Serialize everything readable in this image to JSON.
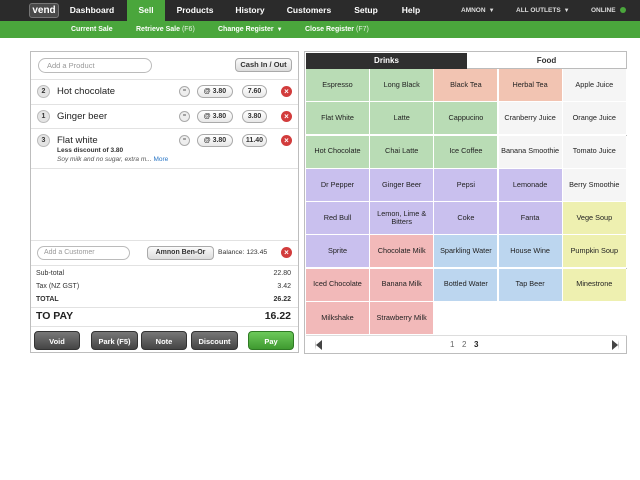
{
  "nav": {
    "logo": "vend",
    "items": [
      "Dashboard",
      "Sell",
      "Products",
      "History",
      "Customers",
      "Setup",
      "Help"
    ],
    "user": "AMNON",
    "outlets": "ALL OUTLETS",
    "status": "ONLINE"
  },
  "subnav": {
    "current_sale": "Current Sale",
    "retrieve_sale": "Retrieve Sale",
    "retrieve_hint": "(F6)",
    "change_register": "Change Register",
    "close_register": "Close Register",
    "close_hint": "(F7)"
  },
  "sale": {
    "add_product_placeholder": "Add a Product",
    "cash_in_out": "Cash In / Out",
    "lines": [
      {
        "qty": "2",
        "name": "Hot chocolate",
        "price": "@ 3.80",
        "total": "7.60",
        "discount": "",
        "note": "",
        "more": ""
      },
      {
        "qty": "1",
        "name": "Ginger beer",
        "price": "@ 3.80",
        "total": "3.80",
        "discount": "",
        "note": "",
        "more": ""
      },
      {
        "qty": "3",
        "name": "Flat white",
        "price": "@ 3.80",
        "total": "11.40",
        "discount": "Less discount of 3.80",
        "note": "Soy milk and no sugar, extra m...",
        "more": "More"
      }
    ],
    "eq_symbol": "=",
    "add_customer_placeholder": "Add a Customer",
    "customer": "Amnon Ben-Or",
    "balance": "Balance: 123.45",
    "subtotal_label": "Sub-total",
    "subtotal": "22.80",
    "tax_label": "Tax (NZ GST)",
    "tax": "3.42",
    "total_label": "TOTAL",
    "total": "26.22",
    "topay_label": "TO PAY",
    "topay": "16.22",
    "buttons": {
      "void": "Void",
      "park": "Park (F5)",
      "note": "Note",
      "discount": "Discount",
      "pay": "Pay"
    }
  },
  "quick_keys": {
    "tabs": [
      "Drinks",
      "Food"
    ],
    "tiles": [
      [
        "Espresso",
        "Long Black",
        "Black Tea",
        "Herbal Tea",
        "Apple Juice"
      ],
      [
        "Flat White",
        "Latte",
        "Cappucino",
        "Cranberry Juice",
        "Orange Juice"
      ],
      [
        "Hot Chocolate",
        "Chai Latte",
        "Ice Coffee",
        "Banana Smoothie",
        "Tomato Juice"
      ],
      [
        "Dr Pepper",
        "Ginger Beer",
        "Pepsi",
        "Lemonade",
        "Berry Smoothie"
      ],
      [
        "Red Bull",
        "Lemon, Lime & Bitters",
        "Coke",
        "Fanta",
        "Vege Soup"
      ],
      [
        "Sprite",
        "Chocolate Milk",
        "Sparkling Water",
        "House Wine",
        "Pumpkin Soup"
      ],
      [
        "Iced Chocolate",
        "Banana Milk",
        "Bottled Water",
        "Tap Beer",
        "Minestrone"
      ],
      [
        "Milkshake",
        "Strawberry Milk",
        "",
        "",
        ""
      ]
    ],
    "colors": [
      [
        "#b9dcb5",
        "#b9dcb5",
        "#f2c4b2",
        "#f2c4b2",
        "#f5f5f5"
      ],
      [
        "#b9dcb5",
        "#b9dcb5",
        "#b9dcb5",
        "#f5f5f5",
        "#f5f5f5"
      ],
      [
        "#b9dcb5",
        "#b9dcb5",
        "#b9dcb5",
        "#f5f5f5",
        "#f5f5f5"
      ],
      [
        "#c9c0ee",
        "#c9c0ee",
        "#c9c0ee",
        "#c9c0ee",
        "#f5f5f5"
      ],
      [
        "#c9c0ee",
        "#c9c0ee",
        "#c9c0ee",
        "#c9c0ee",
        "#eef0b0"
      ],
      [
        "#c9c0ee",
        "#f2b9b9",
        "#bcd6ef",
        "#bcd6ef",
        "#eef0b0"
      ],
      [
        "#f2b9b9",
        "#f2b9b9",
        "#bcd6ef",
        "#bcd6ef",
        "#eef0b0"
      ],
      [
        "#f2b9b9",
        "#f2b9b9",
        "#ffffff",
        "#ffffff",
        "#ffffff"
      ]
    ],
    "pages": [
      "1",
      "2",
      "3"
    ],
    "current_page": "3"
  }
}
